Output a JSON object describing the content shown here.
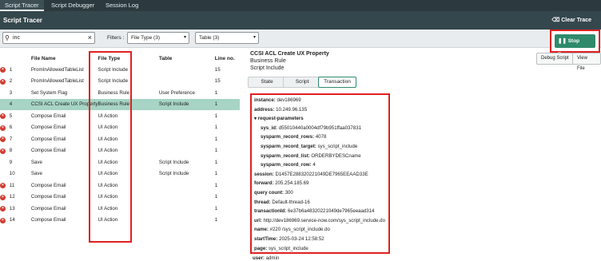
{
  "topnav": {
    "tabs": [
      "Script Tracer",
      "Script Debugger",
      "Session Log"
    ]
  },
  "header": {
    "title": "Script Tracer",
    "clear_label": "Clear Trace"
  },
  "filterbar": {
    "search_value": "inc",
    "filters_label": "Filters :",
    "file_type_value": "File Type (3)",
    "table_value": "Table (3)",
    "stop_label": "Stop Tracer"
  },
  "grid": {
    "headers": {
      "num": "",
      "file_name": "File Name",
      "file_type": "File Type",
      "table": "Table",
      "line": "Line no."
    },
    "rows": [
      {
        "err": true,
        "num": "1",
        "file_name": "PromInAllowedTableList",
        "file_type": "Script Include",
        "table": "",
        "line": "15"
      },
      {
        "err": true,
        "num": "2",
        "file_name": "PromInAllowedTableList",
        "file_type": "Script Include",
        "table": "",
        "line": "15"
      },
      {
        "err": false,
        "num": "3",
        "file_name": "Set System Flag",
        "file_type": "Business Rule",
        "table": "User Preference",
        "line": "1"
      },
      {
        "err": false,
        "num": "4",
        "file_name": "CCSI ACL Create UX Property",
        "file_type": "Business Rule",
        "table": "Script Include",
        "line": "1"
      },
      {
        "err": true,
        "num": "5",
        "file_name": "Compose Email",
        "file_type": "UI Action",
        "table": "",
        "line": "1"
      },
      {
        "err": true,
        "num": "6",
        "file_name": "Compose Email",
        "file_type": "UI Action",
        "table": "",
        "line": "1"
      },
      {
        "err": true,
        "num": "7",
        "file_name": "Compose Email",
        "file_type": "UI Action",
        "table": "",
        "line": "1"
      },
      {
        "err": true,
        "num": "8",
        "file_name": "Compose Email",
        "file_type": "UI Action",
        "table": "",
        "line": "1"
      },
      {
        "err": false,
        "num": "9",
        "file_name": "Save",
        "file_type": "UI Action",
        "table": "Script Include",
        "line": "1"
      },
      {
        "err": false,
        "num": "10",
        "file_name": "Save",
        "file_type": "UI Action",
        "table": "Script Include",
        "line": "1"
      },
      {
        "err": true,
        "num": "11",
        "file_name": "Compose Email",
        "file_type": "UI Action",
        "table": "",
        "line": "1"
      },
      {
        "err": true,
        "num": "12",
        "file_name": "Compose Email",
        "file_type": "UI Action",
        "table": "",
        "line": "1"
      },
      {
        "err": true,
        "num": "13",
        "file_name": "Compose Email",
        "file_type": "UI Action",
        "table": "",
        "line": "1"
      },
      {
        "err": true,
        "num": "14",
        "file_name": "Compose Email",
        "file_type": "UI Action",
        "table": "",
        "line": "1"
      }
    ]
  },
  "detail": {
    "title": "CCSI ACL Create UX Property",
    "subtitle1": "Business Rule",
    "subtitle2": "Script Include",
    "debug_btn": "Debug Script",
    "view_btn": "View File",
    "tabs": [
      "State",
      "Script",
      "Transaction"
    ],
    "fields": [
      {
        "k": "instance:",
        "v": "dev186969",
        "indent": 0
      },
      {
        "k": "address:",
        "v": "10.249.96.135",
        "indent": 0
      },
      {
        "k": "▾ request-parameters",
        "v": "",
        "indent": 0
      },
      {
        "k": "sys_id:",
        "v": "d55010440a0004df79b951ffaa037831",
        "indent": 1
      },
      {
        "k": "sysparm_record_rows:",
        "v": "4078",
        "indent": 1
      },
      {
        "k": "sysparm_record_target:",
        "v": "sys_script_include",
        "indent": 1
      },
      {
        "k": "sysparm_record_list:",
        "v": "ORDERBYDESCname",
        "indent": 1
      },
      {
        "k": "sysparm_record_row:",
        "v": "4",
        "indent": 1
      },
      {
        "k": "session:",
        "v": "D1457E288320221049DE7965EEAAD33E",
        "indent": 0
      },
      {
        "k": "forward:",
        "v": "205.254.185.69",
        "indent": 0
      },
      {
        "k": "query count:",
        "v": "300",
        "indent": 0
      },
      {
        "k": "thread:",
        "v": "Default-thread-16",
        "indent": 0
      },
      {
        "k": "transactionId:",
        "v": "6e37b6a48320221049de7965eeaad314",
        "indent": 0
      },
      {
        "k": "url:",
        "v": "http://dev186969.service-now.com/sys_script_include.do",
        "indent": 0
      },
      {
        "k": "name:",
        "v": "#220 /sys_script_include.do",
        "indent": 0
      },
      {
        "k": "startTime:",
        "v": "2025-03-24 12:58:52",
        "indent": 0
      },
      {
        "k": "page:",
        "v": "sys_script_include",
        "indent": 0
      }
    ],
    "below": {
      "k": "user:",
      "v": "admin"
    }
  },
  "colors": {
    "accent": "#2f8a6b",
    "highlight": "#e02020",
    "selected_row": "#a7d4c4",
    "error": "#cf3a2f"
  }
}
